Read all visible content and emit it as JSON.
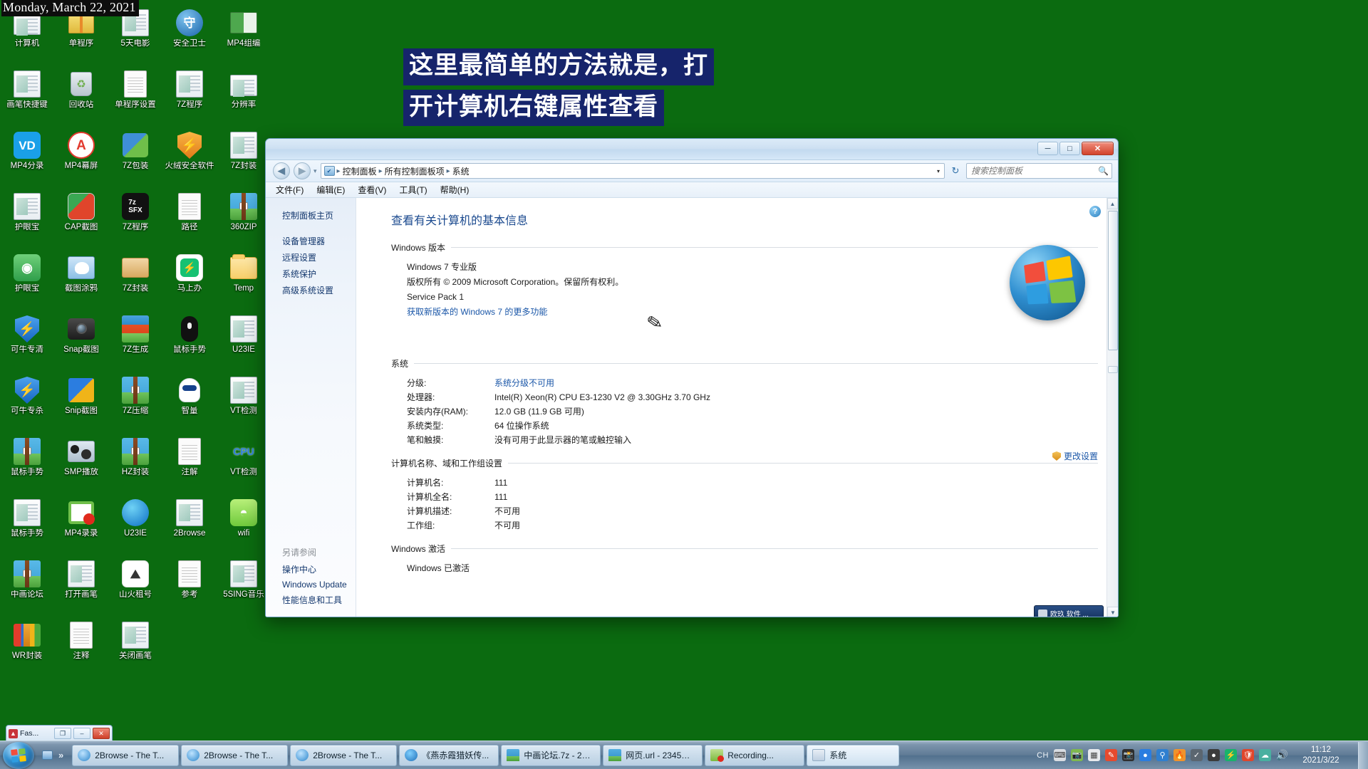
{
  "desktop": {
    "date_stamp": "Monday, March 22, 2021",
    "icons": [
      {
        "label": "计算机",
        "icon": "computer-icon",
        "art": "computer"
      },
      {
        "label": "单程序",
        "icon": "books-zip-icon",
        "art": "books"
      },
      {
        "label": "5天电影",
        "icon": "window-icon",
        "art": "window"
      },
      {
        "label": "安全卫士",
        "icon": "security-guard-icon",
        "art": "bluecircle"
      },
      {
        "label": "MP4组编",
        "icon": "mp4-edit-icon",
        "art": "greenwin"
      },
      {
        "label": "画笔快捷键",
        "icon": "brush-shortcut-icon",
        "art": "window"
      },
      {
        "label": "回收站",
        "icon": "recycle-bin-icon",
        "art": "bin"
      },
      {
        "label": "单程序设置",
        "icon": "document-icon",
        "art": "doc"
      },
      {
        "label": "7Z程序",
        "icon": "window-icon",
        "art": "window"
      },
      {
        "label": "分辨率",
        "icon": "display-icon",
        "art": "computer"
      },
      {
        "label": "MP4分录",
        "icon": "vd-icon",
        "art": "vd"
      },
      {
        "label": "MP4幕屏",
        "icon": "mp4-screen-icon",
        "art": "acircle"
      },
      {
        "label": "7Z包装",
        "icon": "puzzle-icon",
        "art": "puzzle"
      },
      {
        "label": "火绒安全软件",
        "icon": "huorong-shield-icon",
        "art": "orangeshield"
      },
      {
        "label": "7Z封装",
        "icon": "window-icon",
        "art": "window"
      },
      {
        "label": "护眼宝",
        "icon": "window-icon",
        "art": "window"
      },
      {
        "label": "CAP截图",
        "icon": "cap-capture-icon",
        "art": "cap"
      },
      {
        "label": "7Z程序",
        "icon": "7z-sfx-icon",
        "art": "sfx"
      },
      {
        "label": "路径",
        "icon": "document-icon",
        "art": "doc"
      },
      {
        "label": "360ZIP",
        "icon": "zip-icon",
        "art": "zip"
      },
      {
        "label": "护眼宝",
        "icon": "eye-care-icon",
        "art": "eye"
      },
      {
        "label": "截图涂鸦",
        "icon": "paint-capture-icon",
        "art": "paint"
      },
      {
        "label": "7Z封装",
        "icon": "open-box-icon",
        "art": "box"
      },
      {
        "label": "马上办",
        "icon": "mashangban-icon",
        "art": "flash"
      },
      {
        "label": "Temp",
        "icon": "folder-icon",
        "art": "folder"
      },
      {
        "label": "可牛专清",
        "icon": "shield-clean-icon",
        "art": "shield"
      },
      {
        "label": "Snap截图",
        "icon": "camera-icon",
        "art": "camera"
      },
      {
        "label": "7Z生成",
        "icon": "rar-icon",
        "art": "rar"
      },
      {
        "label": "鼠标手势",
        "icon": "mouse-icon",
        "art": "mouse"
      },
      {
        "label": "U23IE",
        "icon": "window-icon",
        "art": "window"
      },
      {
        "label": "可牛专杀",
        "icon": "shield-kill-icon",
        "art": "shield"
      },
      {
        "label": "Snip截图",
        "icon": "snip-icon",
        "art": "snip"
      },
      {
        "label": "7Z压缩",
        "icon": "zip-box-icon",
        "art": "zipbox"
      },
      {
        "label": "智量",
        "icon": "zhiliang-icon",
        "art": "robot"
      },
      {
        "label": "VT检测",
        "icon": "window-icon",
        "art": "window"
      },
      {
        "label": "鼠标手势",
        "icon": "rar-icon",
        "art": "zipbox"
      },
      {
        "label": "SMP播放",
        "icon": "smplayer-icon",
        "art": "film"
      },
      {
        "label": "HZ封装",
        "icon": "rar-icon",
        "art": "zipbox"
      },
      {
        "label": "注解",
        "icon": "document-icon",
        "art": "doc"
      },
      {
        "label": "VT检测",
        "icon": "cpu-icon",
        "art": "cpu"
      },
      {
        "label": "鼠标手势",
        "icon": "window-icon",
        "art": "window"
      },
      {
        "label": "MP4录录",
        "icon": "record-icon",
        "art": "record"
      },
      {
        "label": "U23IE",
        "icon": "edge-icon",
        "art": "edge"
      },
      {
        "label": "2Browse",
        "icon": "window-icon",
        "art": "window"
      },
      {
        "label": "wifi",
        "icon": "wifi-icon",
        "art": "wifi"
      },
      {
        "label": "中画论坛",
        "icon": "rar-icon",
        "art": "zipbox"
      },
      {
        "label": "打开画笔",
        "icon": "window-icon",
        "art": "window"
      },
      {
        "label": "山火租号",
        "icon": "shanhuo-icon",
        "art": "shanhuo"
      },
      {
        "label": "参考",
        "icon": "document-icon",
        "art": "doc"
      },
      {
        "label": "5SING音乐",
        "icon": "window-icon",
        "art": "window"
      },
      {
        "label": "WR封装",
        "icon": "winrar-icon",
        "art": "winrar"
      },
      {
        "label": "注释",
        "icon": "document-icon",
        "art": "doc"
      },
      {
        "label": "关闭画笔",
        "icon": "window-icon",
        "art": "window"
      }
    ]
  },
  "subtitle": {
    "line1": "这里最简单的方法就是，打",
    "line2": "开计算机右键属性查看"
  },
  "fas_window": {
    "title": "Fas...",
    "restore_label": "❐",
    "minimize_label": "–",
    "close_label": "✕"
  },
  "window": {
    "controls": {
      "minimize": "─",
      "maximize": "□",
      "close": "✕"
    },
    "nav": {
      "back": "◀",
      "forward": "▶",
      "dropdown": "▾",
      "refresh": "↻"
    },
    "breadcrumb": {
      "sep": "▸",
      "items": [
        "控制面板",
        "所有控制面板项",
        "系统"
      ],
      "caret": "▾"
    },
    "search": {
      "placeholder": "搜索控制面板",
      "value": "",
      "icon": "🔍"
    },
    "menu": [
      "文件(F)",
      "编辑(E)",
      "查看(V)",
      "工具(T)",
      "帮助(H)"
    ],
    "help_label": "?",
    "sidebar": {
      "home": "控制面板主页",
      "links": [
        "设备管理器",
        "远程设置",
        "系统保护",
        "高级系统设置"
      ],
      "see_also_header": "另请参阅",
      "see_also": [
        "操作中心",
        "Windows Update",
        "性能信息和工具"
      ]
    },
    "content": {
      "page_title": "查看有关计算机的基本信息",
      "sections": [
        {
          "heading": "Windows 版本",
          "lines": [
            "Windows 7 专业版",
            "版权所有 © 2009 Microsoft Corporation。保留所有权利。",
            "Service Pack 1"
          ],
          "link": "获取新版本的 Windows 7 的更多功能"
        },
        {
          "heading": "系统",
          "rows": [
            {
              "key": "分级:",
              "value": "系统分级不可用",
              "is_link": true
            },
            {
              "key": "处理器:",
              "value": "Intel(R) Xeon(R) CPU E3-1230 V2 @ 3.30GHz   3.70 GHz",
              "is_link": false
            },
            {
              "key": "安装内存(RAM):",
              "value": "12.0 GB (11.9 GB 可用)",
              "is_link": false
            },
            {
              "key": "系统类型:",
              "value": "64 位操作系统",
              "is_link": false
            },
            {
              "key": "笔和触摸:",
              "value": "没有可用于此显示器的笔或触控输入",
              "is_link": false
            }
          ]
        },
        {
          "heading": "计算机名称、域和工作组设置",
          "rows": [
            {
              "key": "计算机名:",
              "value": "111",
              "is_link": false
            },
            {
              "key": "计算机全名:",
              "value": "111",
              "is_link": false
            },
            {
              "key": "计算机描述:",
              "value": "不可用",
              "is_link": false
            },
            {
              "key": "工作组:",
              "value": "不可用",
              "is_link": false
            }
          ],
          "action": "更改设置"
        },
        {
          "heading": "Windows 激活",
          "rows": [
            {
              "key": "Windows 已激活",
              "value": "",
              "is_link": false
            }
          ]
        }
      ]
    },
    "toast": {
      "label": "欧玖 软件 ..."
    }
  },
  "taskbar": {
    "start_label": "Start",
    "quicklaunch_chevron": "»",
    "tasks": [
      {
        "label": "2Browse - The T...",
        "icon": "ie-icon",
        "kind": "ie",
        "active": false
      },
      {
        "label": "2Browse - The T...",
        "icon": "ie-icon",
        "kind": "ie",
        "active": false
      },
      {
        "label": "2Browse - The T...",
        "icon": "ie-icon",
        "kind": "ie",
        "active": false
      },
      {
        "label": "《燕赤霞猎妖传...",
        "icon": "player-icon",
        "kind": "wm",
        "active": false
      },
      {
        "label": "中画论坛.7z - 23...",
        "icon": "archive-icon",
        "kind": "zip",
        "active": false
      },
      {
        "label": "网页.url - 2345文...",
        "icon": "archive-icon",
        "kind": "zip",
        "active": false
      },
      {
        "label": "Recording...",
        "icon": "recorder-icon",
        "kind": "rec",
        "active": false
      },
      {
        "label": "系统",
        "icon": "control-panel-icon",
        "kind": "sys",
        "active": true
      }
    ],
    "tray": {
      "ime": "CH",
      "icons": [
        "keyboard-icon",
        "image-sync-icon",
        "google-apps-icon",
        "paint-brush-icon",
        "camera-icon",
        "baidu-icon",
        "usb-icon",
        "huorong-icon",
        "usb-safe-icon",
        "mouse-icon",
        "mashangban-icon",
        "security-icon",
        "cloud-sync-icon",
        "volume-icon"
      ]
    },
    "clock": {
      "time": "11:12",
      "date": "2021/3/22"
    }
  }
}
